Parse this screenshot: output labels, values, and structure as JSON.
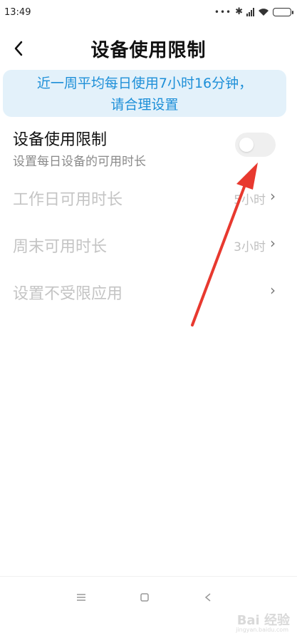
{
  "status_bar": {
    "time": "13:49",
    "dots": "•••",
    "icons": [
      "bluetooth-icon",
      "signal-icon",
      "wifi-icon",
      "battery-icon"
    ]
  },
  "header": {
    "title": "设备使用限制",
    "back_icon": "chevron-left-icon"
  },
  "banner": {
    "line1": "近一周平均每日使用7小时16分钟，",
    "line2": "请合理设置",
    "color": "#1d8fd8",
    "background": "#e3f1fa"
  },
  "settings": {
    "limit": {
      "title": "设备使用限制",
      "subtitle": "设置每日设备的可用时长",
      "enabled": false
    },
    "weekday": {
      "title": "工作日可用时长",
      "value": "5小时"
    },
    "weekend": {
      "title": "周末可用时长",
      "value": "3小时"
    },
    "exempt_apps": {
      "title": "设置不受限应用"
    }
  },
  "annotation": {
    "color": "#e8392f",
    "icon": "red-arrow-annotation"
  },
  "navbar": {
    "icons": [
      "menu-icon",
      "home-icon",
      "back-icon"
    ]
  },
  "watermark": {
    "text": "Bai 经验",
    "sub": "jingyan.baidu.com"
  }
}
